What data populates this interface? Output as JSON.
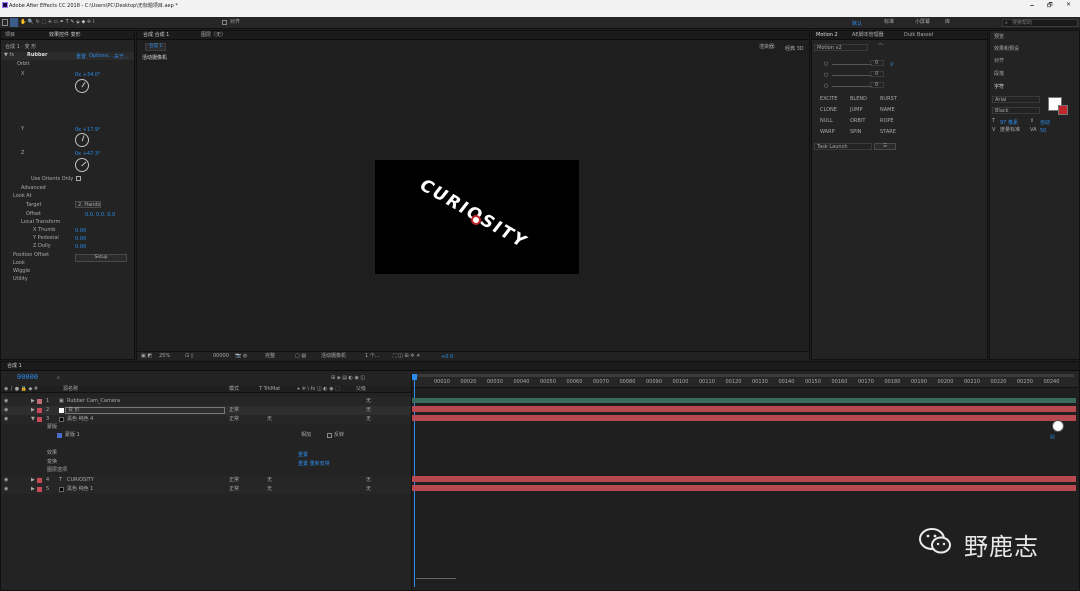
{
  "title_bar": {
    "title": "Adobe After Effects CC 2018 - C:\\Users\\PC\\Desktop\\无标题项目.aep *",
    "minimize": "🗕",
    "maximize": "🗗",
    "close": "✕"
  },
  "menu": [
    "文件(F)",
    "编辑(E)",
    "合成(C)",
    "图层(L)",
    "效果(T)",
    "动画(A)",
    "视图(V)",
    "窗口",
    "帮助(H)"
  ],
  "toolbar": {
    "snap_label": "对齐",
    "workspaces": [
      "默认",
      "标准",
      "小屏幕",
      "库"
    ],
    "search_placeholder": "搜索帮助"
  },
  "effects_panel": {
    "tabs": [
      "项目",
      "效果控件 变形"
    ],
    "breadcrumb": "合成 1 · 变 形",
    "effect_name": "Rubber",
    "reset_label": "重置",
    "about_label": "关于...",
    "options_label": "Options...",
    "section_orbit": "Orbit",
    "x_label": "X",
    "x_value": "0x +34.0°",
    "y_label": "Y",
    "y_value": "0x +17.9°",
    "z_label": "Z",
    "z_value": "0x +47.3°",
    "use_orients": "Use Orients Only",
    "advanced": "Advanced",
    "look_at": "Look At",
    "target_label": "Target",
    "target_value": "2. Hands",
    "offset_label": "Offset",
    "offset_value": "0.0, 0.0, 0.0",
    "local_transform": "Local Transform",
    "thumb": "X Thumb",
    "thumb_value": "0.00",
    "pedestal": "Y Pedestal",
    "pedestal_value": "0.00",
    "dolly": "Z Dolly",
    "dolly_value": "0.00",
    "position_offset": "Position Offset",
    "look": "Look",
    "wiggle": "Wiggle",
    "utility": "Utility",
    "setup": "Setup"
  },
  "comp_panel": {
    "tabs": [
      "合成 合成 1",
      "图层（无）"
    ],
    "comp_tab": "合成 1",
    "renderer_label": "渲染器:",
    "renderer_value": "经典 3D",
    "active_camera": "活动摄像机",
    "image_text": "CURIOSITY",
    "zoom": "25%",
    "timecode": "00000",
    "resolution": "完整",
    "camera": "活动摄像机",
    "views": "1 个...",
    "exposure": "+0.0"
  },
  "motion_panel": {
    "tabs": [
      "Motion 2",
      "AE脚本管理器",
      "Duik Bassel"
    ],
    "version": "Motion v2",
    "slider_values": [
      "0",
      "0",
      "0"
    ],
    "buttons": [
      "EXCITE",
      "BLEND",
      "BURST",
      "CLONE",
      "JUMP",
      "NAME",
      "NULL",
      "ORBIT",
      "ROPE",
      "WARP",
      "SPIN",
      "STARE"
    ],
    "dropdown": "Task Launch"
  },
  "right_panel": {
    "items": [
      "预览",
      "效果和预设",
      "对齐",
      "段落"
    ],
    "char_title": "字符",
    "font": "Arial",
    "style": "Black",
    "size_value": "97 像素",
    "leading_value": "自动",
    "kerning_value": "度量标准",
    "tracking_value": "50"
  },
  "timeline": {
    "tab": "合成 1",
    "timecode": "00000",
    "columns": [
      "源名称",
      "模式",
      "T TrkMat",
      "父级"
    ],
    "layers": [
      {
        "num": "1",
        "name": "Rubber Cam_Camera",
        "mode": "",
        "trk": "",
        "parent": "无",
        "color": "#c26d75"
      },
      {
        "num": "2",
        "name": "变 形",
        "mode": "正常",
        "trk": "",
        "parent": "无",
        "color": "#c74b56"
      },
      {
        "num": "3",
        "name": "黑色 纯色 4",
        "mode": "正常",
        "trk": "无",
        "parent": "无",
        "color": "#c74b56"
      },
      {
        "num": "4",
        "name": "CURIOSITY",
        "mode": "正常",
        "trk": "无",
        "parent": "无",
        "color": "#c74b56"
      },
      {
        "num": "5",
        "name": "黑色 纯色 1",
        "mode": "正常",
        "trk": "无",
        "parent": "无",
        "color": "#c74b56"
      }
    ],
    "sub_rows": [
      "蒙版",
      "蒙版 1",
      "效果",
      "变换",
      "图层选项"
    ],
    "mask_mode": "相加",
    "mask_invert": "反转",
    "reset": "重置",
    "effect_link": "重置 重新安排",
    "ruler": [
      "00010",
      "00020",
      "00030",
      "00040",
      "00050",
      "00060",
      "00070",
      "00080",
      "00090",
      "00100",
      "00110",
      "00120",
      "00130",
      "00140",
      "00150",
      "00160",
      "00170",
      "00180",
      "00190",
      "00200",
      "00210",
      "00220",
      "00230",
      "00240"
    ],
    "badge": "▤"
  },
  "watermark": {
    "text": "野鹿志"
  },
  "colors": {
    "accent": "#2d8ceb",
    "layer_bar": "#b8484f",
    "camera_bar": "#c26d75"
  }
}
